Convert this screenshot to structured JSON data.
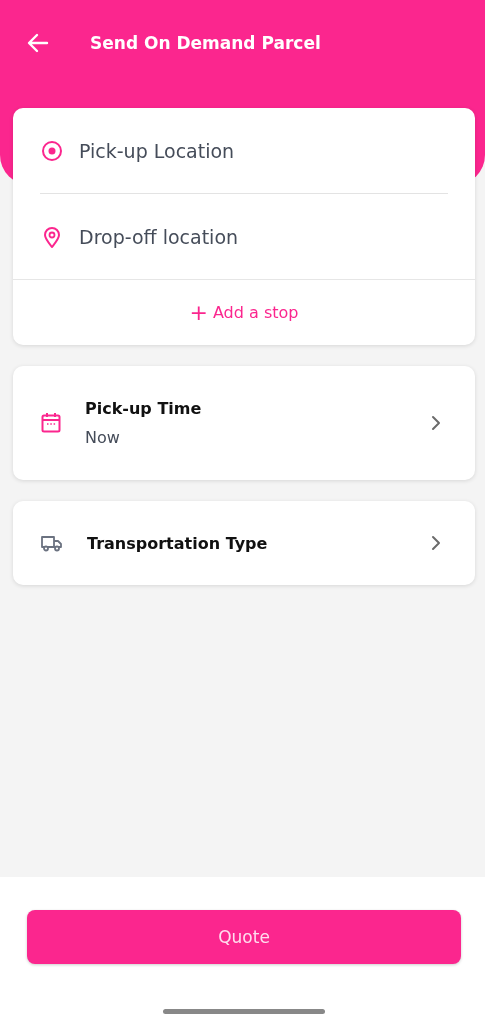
{
  "header": {
    "title": "Send On Demand Parcel"
  },
  "locations": [
    {
      "kind": "pickup",
      "placeholder": "Pick-up Location"
    },
    {
      "kind": "dropoff",
      "placeholder": "Drop-off location"
    }
  ],
  "add_stop": {
    "icon": "+",
    "label": "Add a stop"
  },
  "options": [
    {
      "kind": "time",
      "title": "Pick-up Time",
      "value": "Now"
    },
    {
      "kind": "transport",
      "title": "Transportation Type"
    }
  ],
  "quote_button": "Quote"
}
